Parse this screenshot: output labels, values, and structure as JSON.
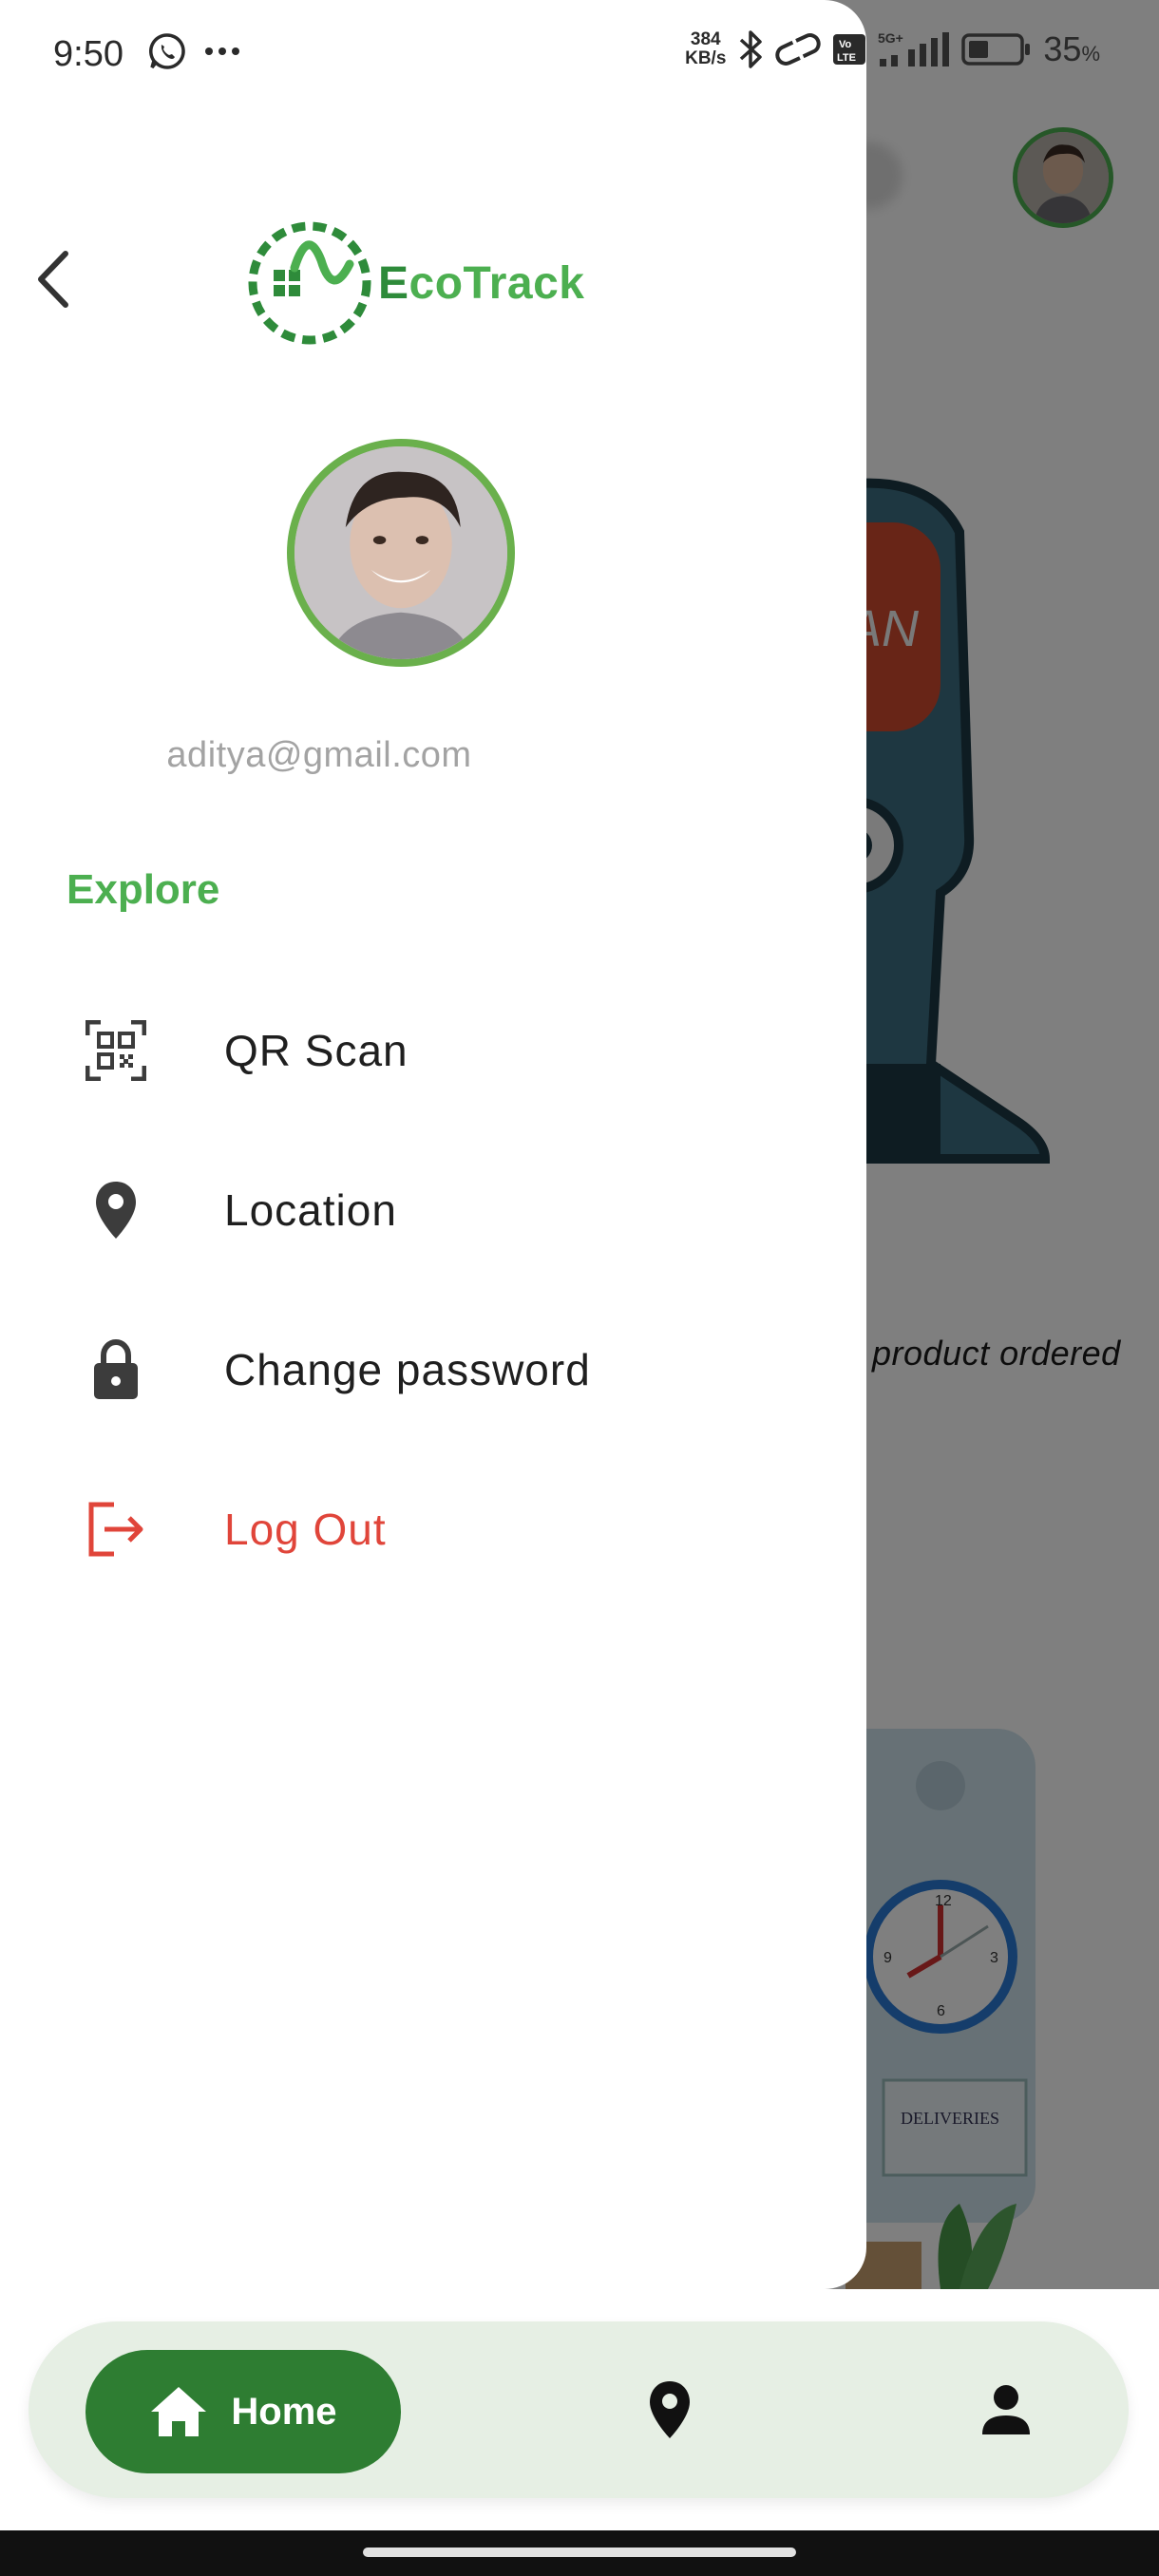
{
  "status_bar": {
    "time": "9:50",
    "net_speed_value": "384",
    "net_speed_unit": "KB/s",
    "network_type": "5G+",
    "battery_percent": "35",
    "battery_symbol": "%"
  },
  "drawer": {
    "logo_text_e": "E",
    "logo_text_rest": "coTrack",
    "email": "aditya@gmail.com",
    "section_title": "Explore",
    "items": [
      {
        "label": "QR Scan",
        "icon": "qr-code-icon"
      },
      {
        "label": "Location",
        "icon": "location-pin-icon"
      },
      {
        "label": "Change password",
        "icon": "lock-icon"
      },
      {
        "label": "Log Out",
        "icon": "logout-icon"
      }
    ]
  },
  "background": {
    "scan_text": "AN",
    "caption": "product ordered",
    "illustration_text": "DELIVERIES"
  },
  "bottom_nav": {
    "home_label": "Home",
    "items": [
      "home-icon",
      "location-pin-icon",
      "person-icon"
    ]
  },
  "colors": {
    "brand_green": "#4caf50",
    "nav_active": "#2e7d32",
    "logout_red": "#e0453a",
    "nav_bg": "#e6efe4"
  }
}
